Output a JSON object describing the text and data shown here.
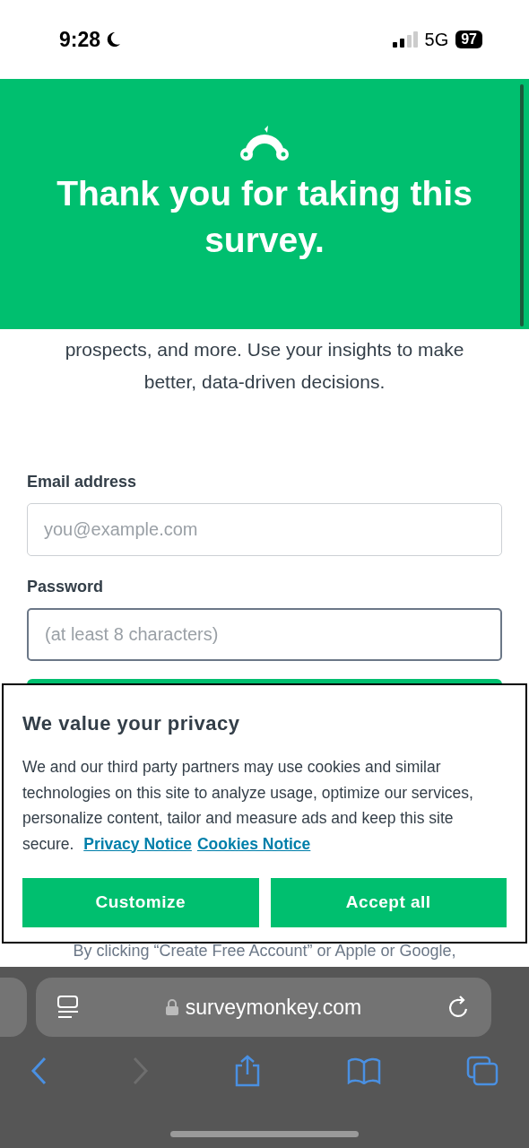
{
  "status_bar": {
    "time": "9:28",
    "network": "5G",
    "battery": "97"
  },
  "header": {
    "title": "Thank you for taking this survey."
  },
  "intro": {
    "lines": [
      "prospects, and more. Use your insights to make",
      "better, data-driven decisions."
    ]
  },
  "form": {
    "fields": [
      {
        "label": "Email address",
        "placeholder": "you@example.com",
        "focused": false
      },
      {
        "label": "Password",
        "placeholder": "(at least 8 characters)",
        "focused": true
      }
    ],
    "terms": "By clicking “Create Free Account” or Apple or Google,"
  },
  "cookie_dialog": {
    "title": "We value your privacy",
    "body": "We and our third party partners may use cookies and similar technologies on this site to analyze usage, optimize our services, personalize content, tailor and measure ads and keep this site secure.",
    "links": [
      "Privacy Notice",
      "Cookies Notice"
    ],
    "buttons": [
      "Customize",
      "Accept all"
    ]
  },
  "browser": {
    "url": "surveymonkey.com"
  }
}
